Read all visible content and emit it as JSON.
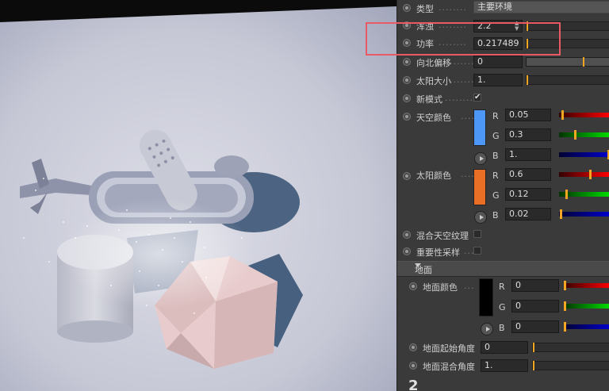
{
  "panel": {
    "type_label": "类型",
    "type_value": "主要环境",
    "turbidity_label": "浑浊",
    "turbidity_value": "2.2",
    "power_label": "功率",
    "power_value": "0.217489",
    "north_offset_label": "向北偏移",
    "north_offset_value": "0",
    "sun_size_label": "太阳大小",
    "sun_size_value": "1.",
    "new_mode_label": "新模式",
    "new_mode_checked": "✔",
    "sky_color_label": "天空颜色",
    "sky_color": "#4d97f7",
    "sky_r": "0.05",
    "sky_g": "0.3",
    "sky_b": "1.",
    "sun_color_label": "太阳颜色",
    "sun_color": "#e86f25",
    "sun_r": "0.6",
    "sun_g": "0.12",
    "sun_b": "0.02",
    "blend_sky_texture_label": "混合天空纹理",
    "importance_sampling_label": "重要性采样",
    "ground_section_label": "地面",
    "ground_color_label": "地面颜色",
    "ground_color": "#000000",
    "ground_r": "0",
    "ground_g": "0",
    "ground_b": "0",
    "ground_start_angle_label": "地面起始角度",
    "ground_start_angle_value": "0",
    "ground_blend_angle_label": "地面混合角度",
    "ground_blend_angle_value": "1.",
    "channel_r": "R",
    "channel_g": "G",
    "channel_b": "B",
    "dots": "........",
    "spin_glyph": "▲▼",
    "bottom_digit": "2"
  },
  "levels": {
    "turbidity_slider": 0.0,
    "power_slider": 0.0,
    "north_offset_slider": 0.68,
    "sun_size_slider": 0.0
  }
}
